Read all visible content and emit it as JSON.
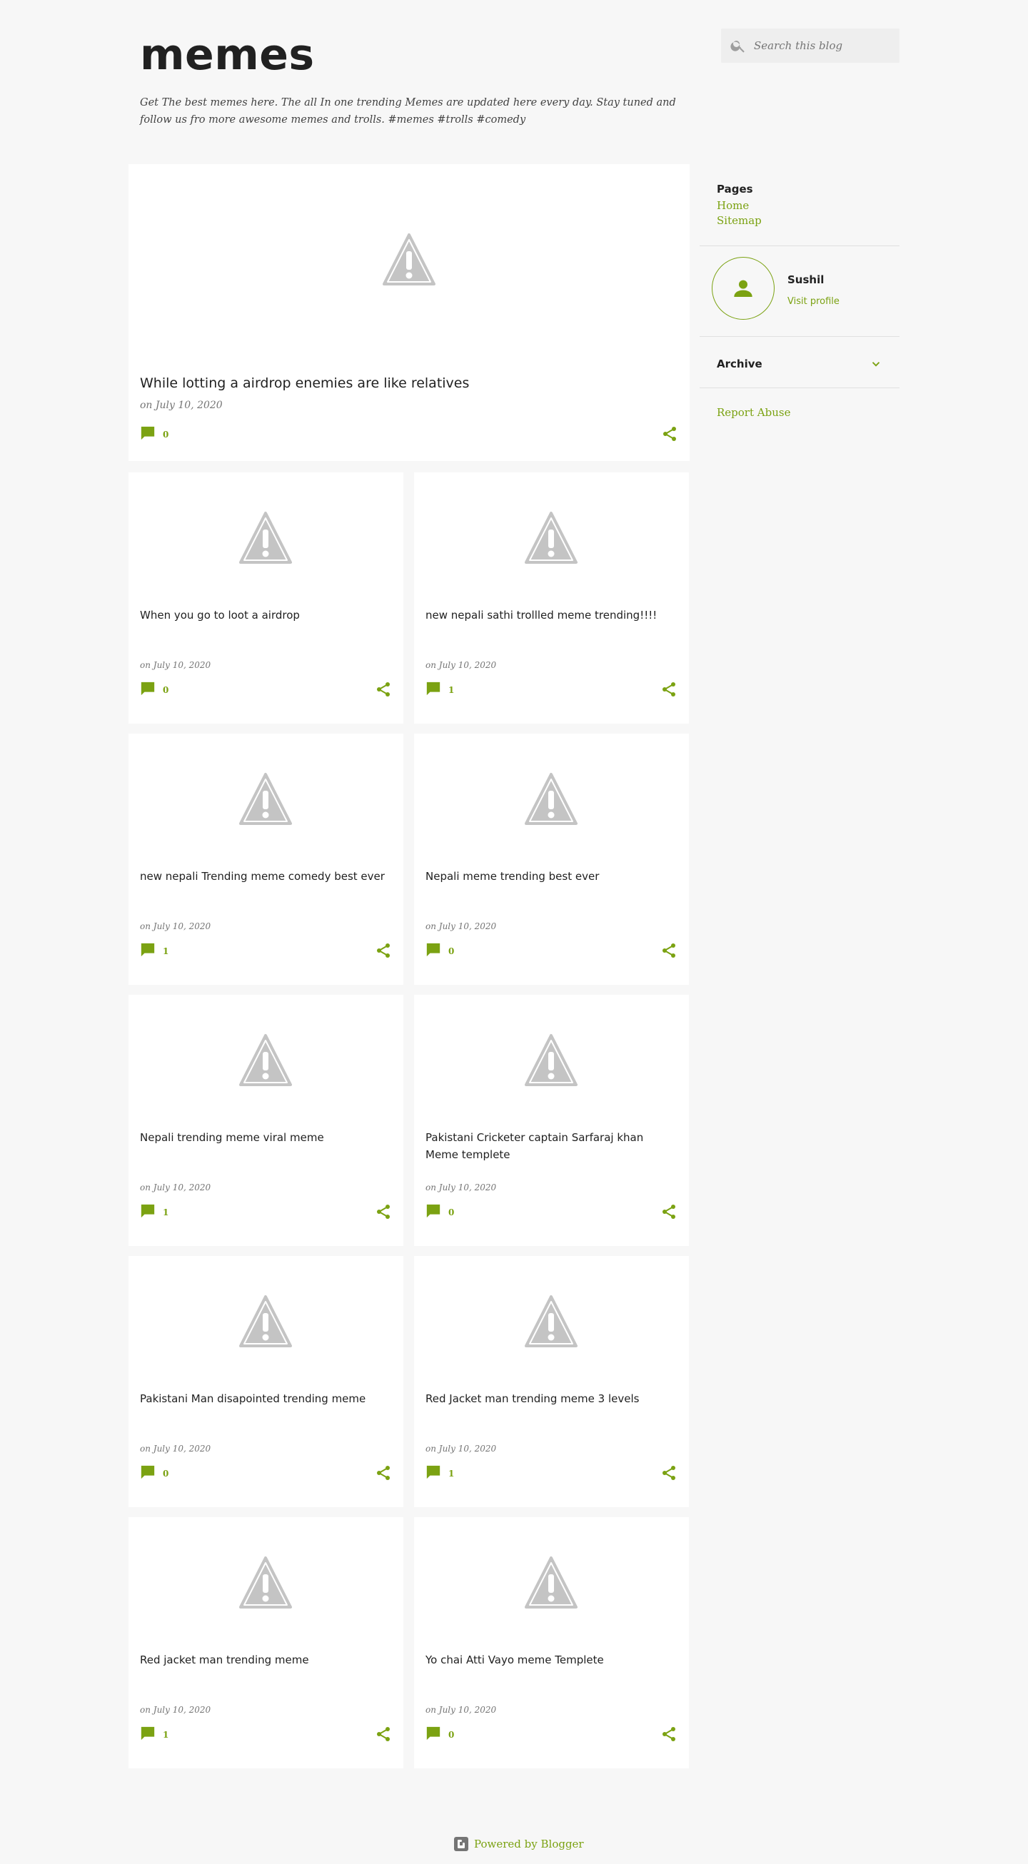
{
  "blog": {
    "title": "memes",
    "description": "Get The best memes here. The all In one trending Memes are updated here every day. Stay tuned and follow us fro more awesome memes and trolls. #memes #trolls #comedy"
  },
  "search": {
    "placeholder": "Search this blog"
  },
  "featured": {
    "title": "While lotting a airdrop enemies are like relatives",
    "date": "on July 10, 2020",
    "comments": "0"
  },
  "posts": [
    {
      "title": "When you go to loot a airdrop",
      "date": "on July 10, 2020",
      "comments": "0"
    },
    {
      "title": "new nepali sathi trollled meme trending!!!!",
      "date": "on July 10, 2020",
      "comments": "1"
    },
    {
      "title": "new nepali Trending meme comedy best ever",
      "date": "on July 10, 2020",
      "comments": "1"
    },
    {
      "title": "Nepali meme trending best ever",
      "date": "on July 10, 2020",
      "comments": "0"
    },
    {
      "title": "Nepali trending meme viral meme",
      "date": "on July 10, 2020",
      "comments": "1"
    },
    {
      "title": "Pakistani Cricketer captain Sarfaraj khan Meme templete",
      "date": "on July 10, 2020",
      "comments": "0"
    },
    {
      "title": "Pakistani Man disapointed trending meme",
      "date": "on July 10, 2020",
      "comments": "0"
    },
    {
      "title": "Red Jacket man trending meme 3 levels",
      "date": "on July 10, 2020",
      "comments": "1"
    },
    {
      "title": "Red jacket man trending meme",
      "date": "on July 10, 2020",
      "comments": "1"
    },
    {
      "title": "Yo chai Atti Vayo meme Templete",
      "date": "on July 10, 2020",
      "comments": "0"
    }
  ],
  "sidebar": {
    "pages_heading": "Pages",
    "pages": [
      "Home",
      "Sitemap"
    ],
    "profile_name": "Sushil",
    "profile_link": "Visit profile",
    "archive_heading": "Archive",
    "report_abuse": "Report Abuse"
  },
  "footer": {
    "powered_by": "Powered by Blogger"
  },
  "colors": {
    "accent": "#7ba212",
    "background": "#f7f7f7",
    "card": "#ffffff",
    "placeholder": "#c4c4c4"
  },
  "icons": {
    "search": "search-icon",
    "comment": "comment-icon",
    "share": "share-icon",
    "image_placeholder": "broken-image-icon",
    "profile": "person-icon",
    "archive": "chevron-down-icon",
    "blogger": "blogger-logo-icon"
  }
}
